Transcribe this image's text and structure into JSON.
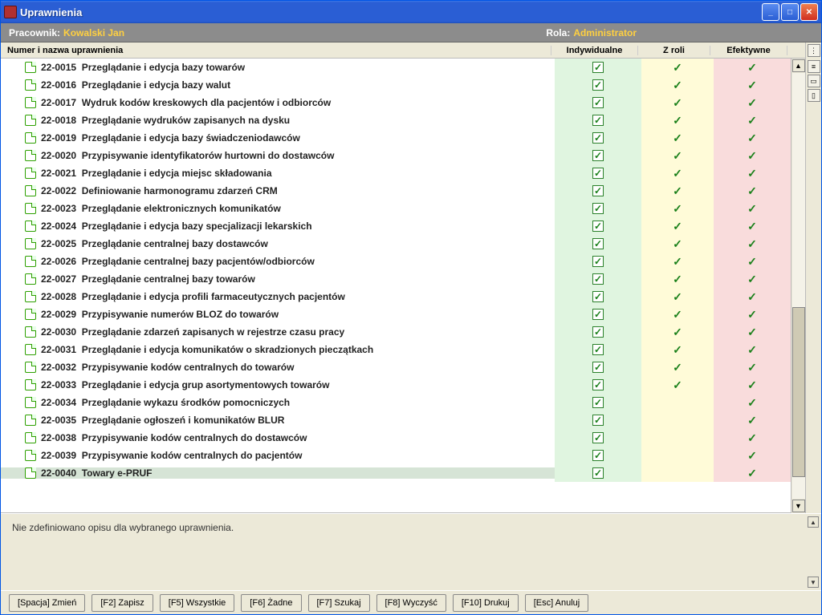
{
  "window": {
    "title": "Uprawnienia"
  },
  "header": {
    "employeeLabel": "Pracownik:",
    "employeeValue": "Kowalski Jan",
    "roleLabel": "Rola:",
    "roleValue": "Administrator"
  },
  "columns": {
    "name": "Numer i nazwa uprawnienia",
    "individual": "Indywidualne",
    "fromRole": "Z roli",
    "effective": "Efektywne"
  },
  "rows": [
    {
      "code": "22-0015",
      "text": "Przeglądanie i edycja bazy towarów",
      "ind": true,
      "role": true,
      "eff": true,
      "selected": false
    },
    {
      "code": "22-0016",
      "text": "Przeglądanie i edycja bazy walut",
      "ind": true,
      "role": true,
      "eff": true,
      "selected": false
    },
    {
      "code": "22-0017",
      "text": "Wydruk kodów kreskowych dla pacjentów i odbiorców",
      "ind": true,
      "role": true,
      "eff": true,
      "selected": false
    },
    {
      "code": "22-0018",
      "text": "Przeglądanie wydruków zapisanych na dysku",
      "ind": true,
      "role": true,
      "eff": true,
      "selected": false
    },
    {
      "code": "22-0019",
      "text": "Przeglądanie i edycja bazy świadczeniodawców",
      "ind": true,
      "role": true,
      "eff": true,
      "selected": false
    },
    {
      "code": "22-0020",
      "text": "Przypisywanie identyfikatorów hurtowni do dostawców",
      "ind": true,
      "role": true,
      "eff": true,
      "selected": false
    },
    {
      "code": "22-0021",
      "text": "Przeglądanie i edycja miejsc składowania",
      "ind": true,
      "role": true,
      "eff": true,
      "selected": false
    },
    {
      "code": "22-0022",
      "text": "Definiowanie harmonogramu zdarzeń CRM",
      "ind": true,
      "role": true,
      "eff": true,
      "selected": false
    },
    {
      "code": "22-0023",
      "text": "Przeglądanie elektronicznych komunikatów",
      "ind": true,
      "role": true,
      "eff": true,
      "selected": false
    },
    {
      "code": "22-0024",
      "text": "Przeglądanie i edycja bazy specjalizacji lekarskich",
      "ind": true,
      "role": true,
      "eff": true,
      "selected": false
    },
    {
      "code": "22-0025",
      "text": "Przeglądanie centralnej bazy dostawców",
      "ind": true,
      "role": true,
      "eff": true,
      "selected": false
    },
    {
      "code": "22-0026",
      "text": "Przeglądanie centralnej bazy pacjentów/odbiorców",
      "ind": true,
      "role": true,
      "eff": true,
      "selected": false
    },
    {
      "code": "22-0027",
      "text": "Przeglądanie centralnej bazy towarów",
      "ind": true,
      "role": true,
      "eff": true,
      "selected": false
    },
    {
      "code": "22-0028",
      "text": "Przeglądanie i edycja profili farmaceutycznych pacjentów",
      "ind": true,
      "role": true,
      "eff": true,
      "selected": false
    },
    {
      "code": "22-0029",
      "text": "Przypisywanie numerów BLOZ do towarów",
      "ind": true,
      "role": true,
      "eff": true,
      "selected": false
    },
    {
      "code": "22-0030",
      "text": "Przeglądanie zdarzeń zapisanych w rejestrze czasu pracy",
      "ind": true,
      "role": true,
      "eff": true,
      "selected": false
    },
    {
      "code": "22-0031",
      "text": "Przeglądanie i edycja komunikatów o skradzionych pieczątkach",
      "ind": true,
      "role": true,
      "eff": true,
      "selected": false
    },
    {
      "code": "22-0032",
      "text": "Przypisywanie kodów centralnych do towarów",
      "ind": true,
      "role": true,
      "eff": true,
      "selected": false
    },
    {
      "code": "22-0033",
      "text": "Przeglądanie i edycja grup asortymentowych towarów",
      "ind": true,
      "role": true,
      "eff": true,
      "selected": false
    },
    {
      "code": "22-0034",
      "text": "Przeglądanie wykazu środków pomocniczych",
      "ind": true,
      "role": false,
      "eff": true,
      "selected": false
    },
    {
      "code": "22-0035",
      "text": "Przeglądanie ogłoszeń i komunikatów BLUR",
      "ind": true,
      "role": false,
      "eff": true,
      "selected": false
    },
    {
      "code": "22-0038",
      "text": "Przypisywanie kodów centralnych do dostawców",
      "ind": true,
      "role": false,
      "eff": true,
      "selected": false
    },
    {
      "code": "22-0039",
      "text": "Przypisywanie kodów centralnych do pacjentów",
      "ind": true,
      "role": false,
      "eff": true,
      "selected": false
    },
    {
      "code": "22-0040",
      "text": "Towary e-PRUF",
      "ind": true,
      "role": false,
      "eff": true,
      "selected": true
    }
  ],
  "description": "Nie zdefiniowano opisu dla wybranego uprawnienia.",
  "buttons": [
    "[Spacja] Zmień",
    "[F2] Zapisz",
    "[F5] Wszystkie",
    "[F6] Żadne",
    "[F7] Szukaj",
    "[F8] Wyczyść",
    "[F10] Drukuj",
    "[Esc] Anuluj"
  ]
}
